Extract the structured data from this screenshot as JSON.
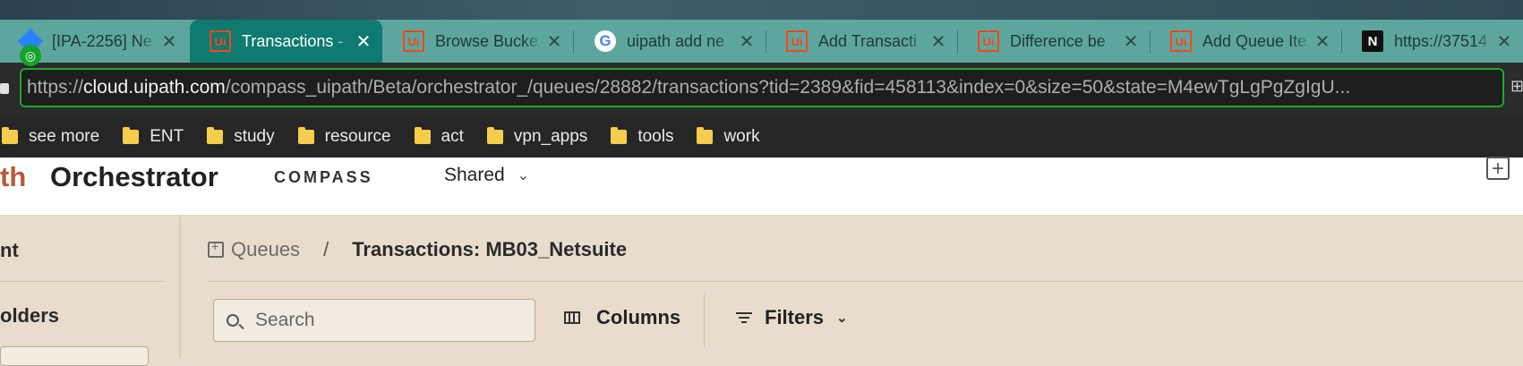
{
  "browser": {
    "tabs": [
      {
        "title": "[IPA-2256] Ne",
        "icon": "jira-icon",
        "active": false
      },
      {
        "title": "Transactions -",
        "icon": "uipath-icon",
        "active": true
      },
      {
        "title": "Browse Bucke",
        "icon": "uipath-icon",
        "active": false
      },
      {
        "title": "uipath add ne",
        "icon": "google-icon",
        "active": false
      },
      {
        "title": "Add Transacti",
        "icon": "uipath-icon",
        "active": false
      },
      {
        "title": "Difference be",
        "icon": "uipath-icon",
        "active": false
      },
      {
        "title": "Add Queue Ite",
        "icon": "uipath-icon",
        "active": false
      },
      {
        "title": "https://37514",
        "icon": "notion-icon",
        "active": false
      }
    ],
    "address": {
      "scheme": "https://",
      "host": "cloud.uipath.com",
      "path": "/compass_uipath/Beta/orchestrator_/queues/28882/transactions?tid=2389&fid=458113&index=0&size=50&state=M4ewTgLgPgZgIgU..."
    },
    "bookmarks": [
      "see more",
      "ENT",
      "study",
      "resource",
      "act",
      "vpn_apps",
      "tools",
      "work"
    ]
  },
  "header": {
    "logo_fragment": "th",
    "app_name": "Orchestrator",
    "tenant": "COMPASS",
    "folder": "Shared"
  },
  "leftnav": {
    "item1": "nt",
    "item2": "olders"
  },
  "breadcrumb": {
    "parent": "Queues",
    "separator": "/",
    "current": "Transactions: MB03_Netsuite"
  },
  "toolbar": {
    "search_placeholder": "Search",
    "columns_label": "Columns",
    "filters_label": "Filters"
  },
  "colors": {
    "tabstrip": "#5da69e",
    "active_tab": "#0f7a70",
    "address_border": "#1ca830",
    "page_bg": "#e8ddcc"
  }
}
